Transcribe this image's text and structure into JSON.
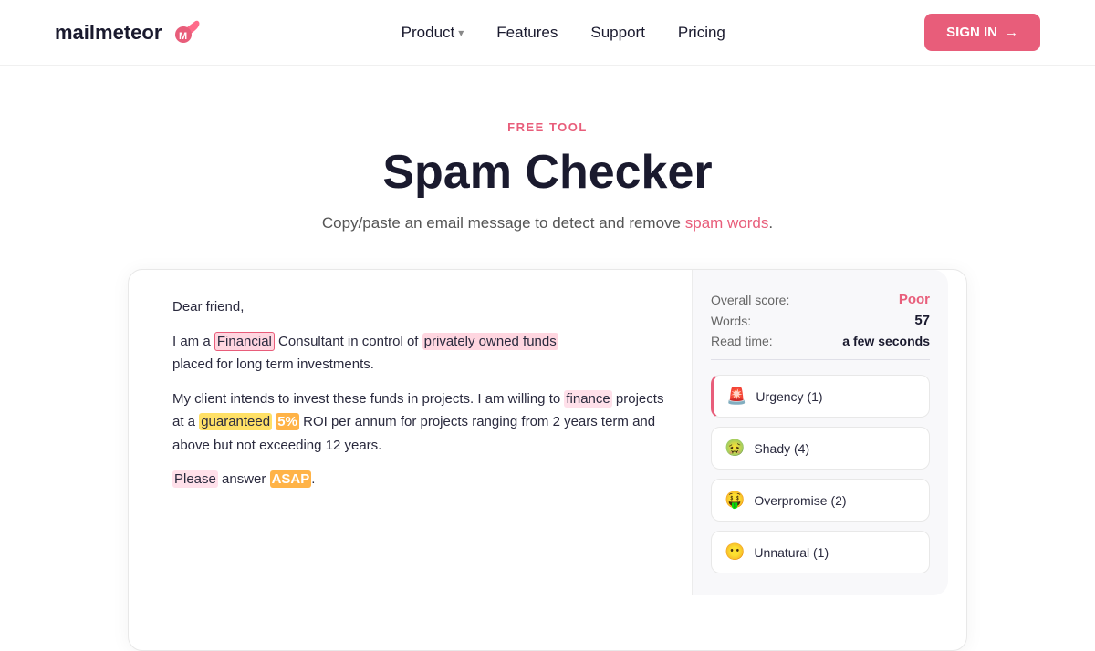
{
  "nav": {
    "logo_text": "mailmeteor",
    "links": [
      {
        "label": "Product",
        "has_chevron": true
      },
      {
        "label": "Features",
        "has_chevron": false
      },
      {
        "label": "Support",
        "has_chevron": false
      },
      {
        "label": "Pricing",
        "has_chevron": false
      }
    ],
    "sign_in_label": "SIGN IN"
  },
  "hero": {
    "badge": "FREE TOOL",
    "title": "Spam Checker",
    "subtitle_before": "Copy/paste an email message to detect and remove ",
    "subtitle_link": "spam words",
    "subtitle_after": "."
  },
  "results": {
    "overall_label": "Overall score:",
    "overall_value": "Poor",
    "words_label": "Words:",
    "words_value": "57",
    "read_time_label": "Read time:",
    "read_time_value": "a few seconds",
    "categories": [
      {
        "icon": "🚨",
        "label": "Urgency (1)",
        "type": "urgency"
      },
      {
        "icon": "🤢",
        "label": "Shady (4)",
        "type": "shady"
      },
      {
        "icon": "🤑",
        "label": "Overpromise (2)",
        "type": "overpromise"
      },
      {
        "icon": "😶",
        "label": "Unnatural (1)",
        "type": "unnatural"
      }
    ]
  }
}
